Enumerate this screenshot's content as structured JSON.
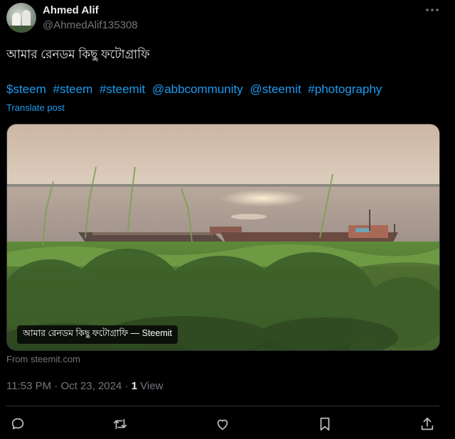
{
  "author": {
    "name": "Ahmed Alif",
    "handle": "@AhmedAlif135308"
  },
  "post": {
    "text": "আমার রেনডম কিছু ফটোগ্রাফি",
    "hashtags": [
      "$steem",
      "#steem",
      "#steemit",
      "@abbcommunity",
      "@steemit",
      "#photography"
    ],
    "translate_label": "Translate post"
  },
  "card": {
    "caption": "আমার রেনডম কিছু ফটোগ্রাফি — Steemit",
    "source": "From steemit.com"
  },
  "meta": {
    "time": "11:53 PM",
    "separator": "·",
    "date": "Oct 23, 2024",
    "views_count": "1",
    "views_label": "View"
  },
  "actions": [
    "reply-icon",
    "repost-icon",
    "like-icon",
    "bookmark-icon",
    "share-icon"
  ],
  "colors": {
    "background": "#000000",
    "text": "#e7e9ea",
    "muted": "#71767b",
    "link": "#1d9bf0",
    "border": "#2f3336"
  }
}
